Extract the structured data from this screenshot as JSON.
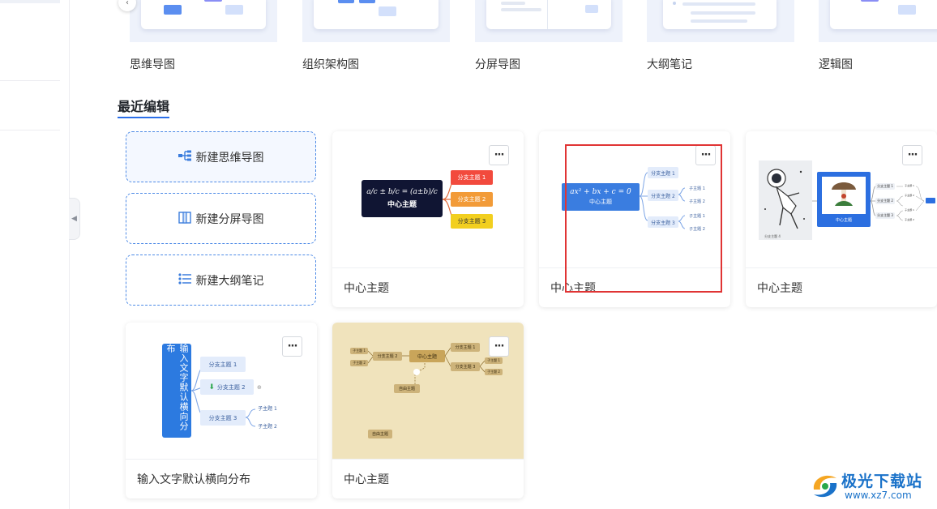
{
  "templates": [
    {
      "label": "思维导图"
    },
    {
      "label": "组织架构图"
    },
    {
      "label": "分屏导图"
    },
    {
      "label": "大纲笔记"
    },
    {
      "label": "逻辑图"
    }
  ],
  "section": {
    "title": "最近编辑"
  },
  "new_buttons": [
    {
      "label": "新建思维导图",
      "icon": "mindmap-icon"
    },
    {
      "label": "新建分屏导图",
      "icon": "split-icon"
    },
    {
      "label": "新建大纲笔记",
      "icon": "outline-icon"
    }
  ],
  "cards": [
    {
      "name": "中心主题",
      "thumb": {
        "formula": "a/c ± b/c = (a±b)/c",
        "center": "中心主题",
        "branches": [
          "分支主题 1",
          "分支主题 2",
          "分支主题 3"
        ],
        "colors": [
          "#f24a3d",
          "#f29b38",
          "#f2cf1f"
        ]
      }
    },
    {
      "name": "中心主题",
      "thumb": {
        "formula": "ax² + bx + c = 0",
        "center": "中心主题",
        "branches": [
          "分支主题 1",
          "分支主题 2",
          "分支主题 3"
        ],
        "sub": [
          "子主题 1",
          "子主题 2",
          "子主题 1",
          "子主题 2"
        ]
      }
    },
    {
      "name": "中心主题",
      "thumb": {
        "center": "中心主题",
        "caption": "分支主题 4",
        "branches": [
          "分支主题 1",
          "分支主题 2",
          "分支主题 3"
        ],
        "sub": [
          "子主题 1",
          "子主题 2",
          "子主题 1",
          "子主题 2"
        ]
      }
    },
    {
      "name": "输入文字默认横向分布",
      "thumb": {
        "center": "输入文字默认横向分布",
        "branches": [
          "分支主题 1",
          "分支主题 2",
          "分支主题 3"
        ],
        "sub": [
          "子主题 1",
          "子主题 2"
        ]
      }
    },
    {
      "name": "中心主题",
      "thumb": {
        "center": "中心主题",
        "left": [
          "分支主题 2"
        ],
        "left_sub": [
          "子主题 1",
          "子主题 2"
        ],
        "right": [
          "分支主题 1",
          "分支主题 3"
        ],
        "right_sub": [
          "子主题 1",
          "子主题 2"
        ],
        "free1": "自由主题",
        "free2": "自由主题"
      }
    }
  ],
  "more_label": "···",
  "watermark": {
    "title": "极光下载站",
    "url": "www.xz7.com"
  },
  "colors": {
    "accent": "#2a6ee8",
    "highlight": "#e03434"
  }
}
